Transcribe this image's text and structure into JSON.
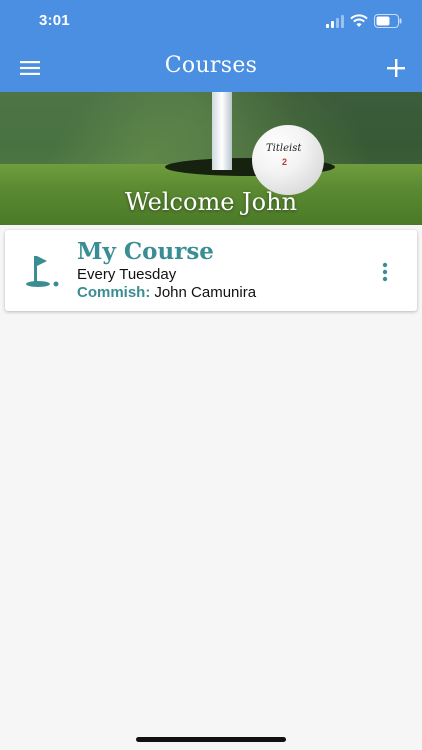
{
  "status_bar": {
    "time": "3:01"
  },
  "app_bar": {
    "title": "Courses",
    "menu_icon": "hamburger-menu-icon",
    "add_icon": "plus-icon"
  },
  "hero": {
    "welcome": "Welcome John",
    "ball_brand": "Titleist",
    "ball_number": "2"
  },
  "courses": [
    {
      "name": "My Course",
      "schedule": "Every Tuesday",
      "commish_label": "Commish:",
      "commish_name": "John Camunira",
      "icon": "golf-flag-icon",
      "more_icon": "more-vert-icon"
    }
  ],
  "colors": {
    "app_bar": "#4a8fe2",
    "accent_teal": "#3a8e93",
    "background": "#f6f6f6"
  }
}
